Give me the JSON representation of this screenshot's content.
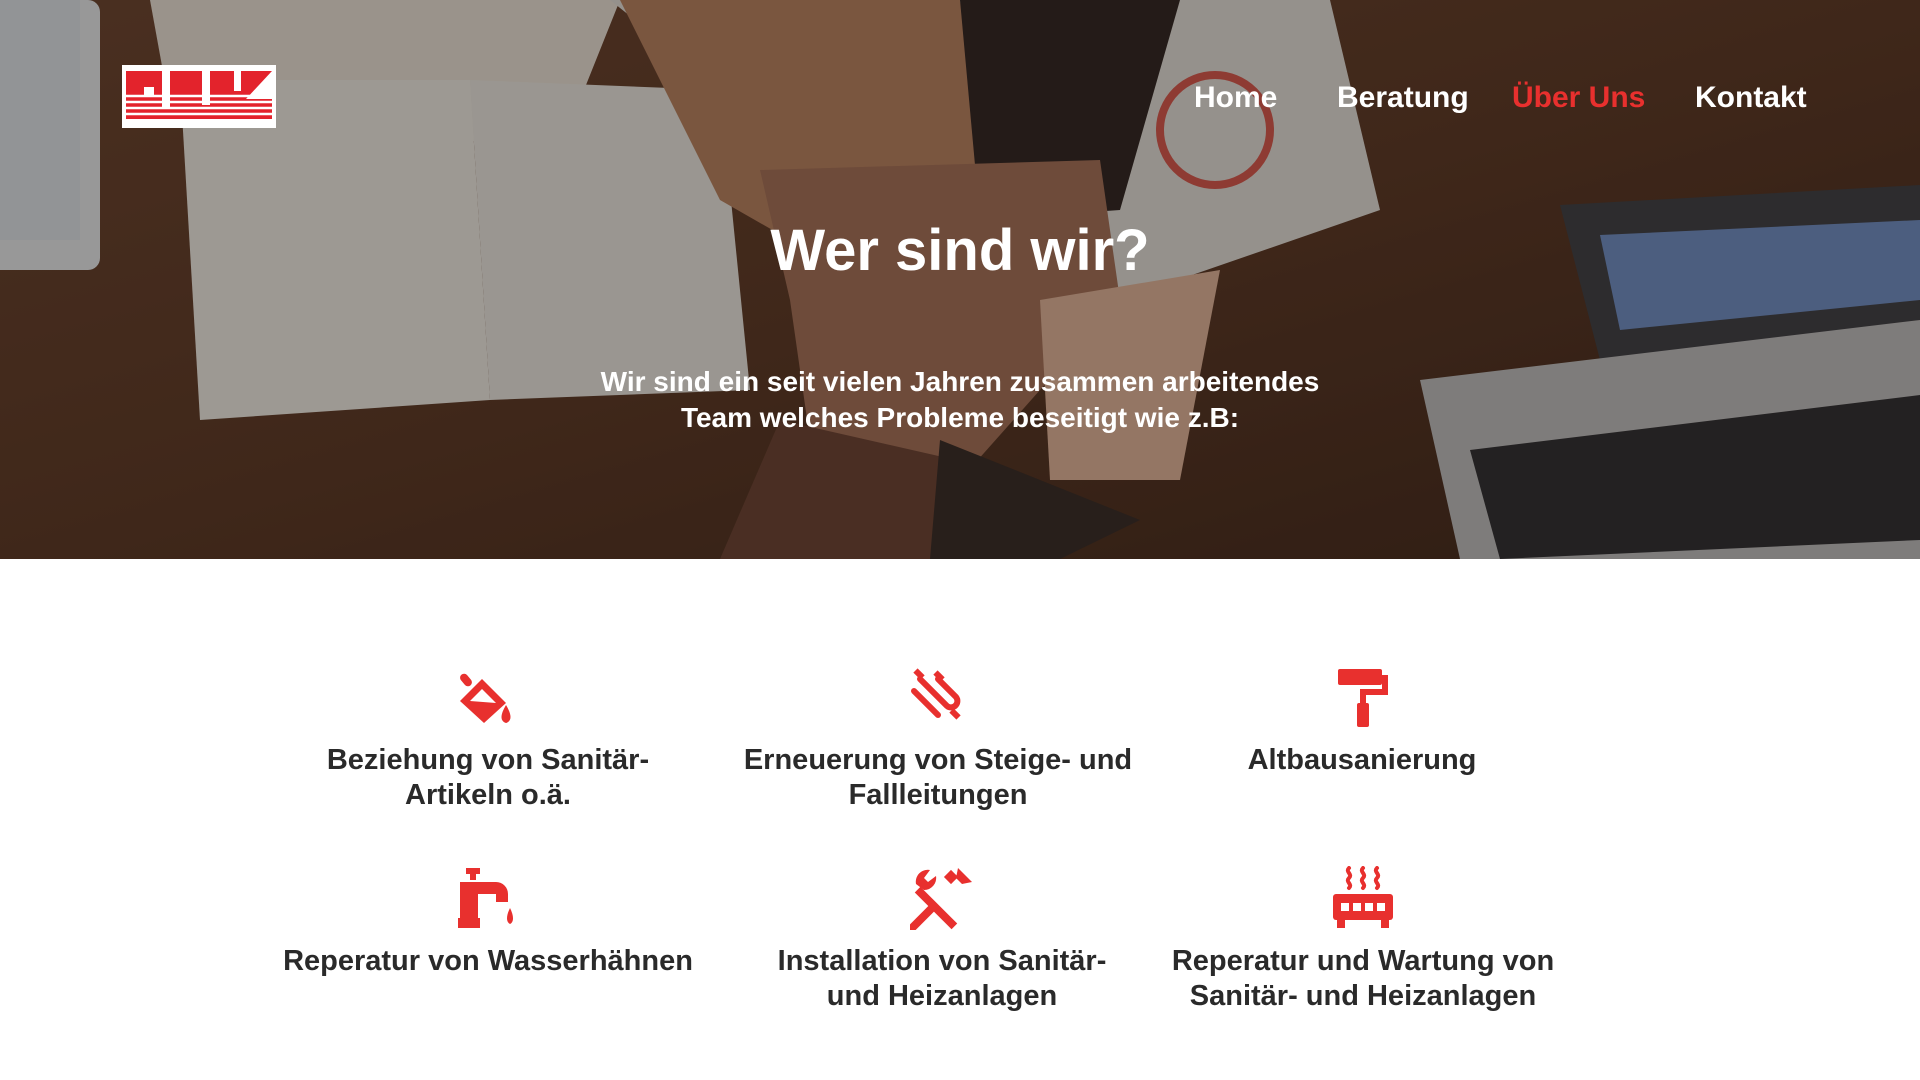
{
  "header": {
    "logo_text": "PLUS",
    "nav": [
      {
        "label": "Home",
        "active": false
      },
      {
        "label": "Beratung",
        "active": false
      },
      {
        "label": "Über Uns",
        "active": true
      },
      {
        "label": "Kontakt",
        "active": false
      }
    ]
  },
  "hero": {
    "title": "Wer sind wir?",
    "subtitle_line1": "Wir sind ein seit vielen Jahren zusammen arbeitendes",
    "subtitle_line2": "Team welches Probleme beseitigt wie z.B:"
  },
  "services": [
    {
      "icon": "paint-bucket-icon",
      "line1": "Beziehung von Sanitär-",
      "line2": "Artikeln o.ä."
    },
    {
      "icon": "pipes-icon",
      "line1": "Erneuerung von Steige- und",
      "line2": "Fallleitungen"
    },
    {
      "icon": "paint-roller-icon",
      "line1": "Altbausanierung",
      "line2": ""
    },
    {
      "icon": "faucet-icon",
      "line1": "Reperatur von Wasserhähnen",
      "line2": ""
    },
    {
      "icon": "tools-icon",
      "line1": "Installation von Sanitär-",
      "line2": "und Heizanlagen"
    },
    {
      "icon": "heater-icon",
      "line1": "Reperatur und Wartung von",
      "line2": "Sanitär- und Heizanlagen"
    }
  ],
  "colors": {
    "accent": "#e8302e",
    "nav_text": "#ffffff",
    "heading_text": "#2a2a2a"
  }
}
